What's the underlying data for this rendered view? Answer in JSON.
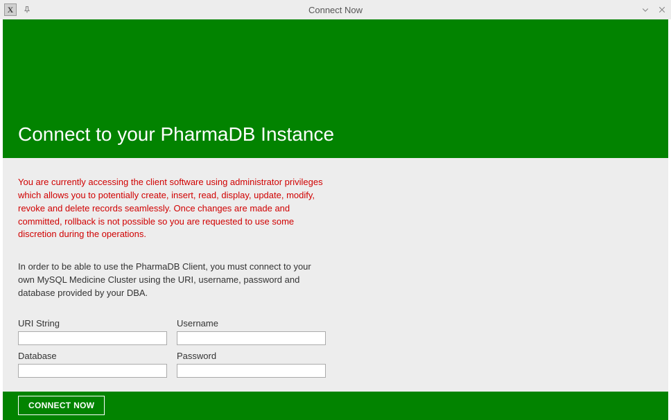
{
  "window": {
    "title": "Connect Now",
    "app_icon_letter": "X"
  },
  "header": {
    "title": "Connect to your PharmaDB Instance"
  },
  "body": {
    "warning": "You are currently accessing the client software using administrator privileges which allows you to potentially create, insert, read, display, update, modify, revoke and delete records seamlessly. Once changes are made and committed, rollback is not possible so you are requested to use some discretion during the operations.",
    "info": "In order to be able to use the PharmaDB Client, you must connect to your own MySQL Medicine Cluster using the URI, username, password and database provided by your DBA.",
    "labels": {
      "uri": "URI String",
      "username": "Username",
      "database": "Database",
      "password": "Password"
    },
    "values": {
      "uri": "",
      "username": "",
      "database": "",
      "password": ""
    }
  },
  "footer": {
    "connect_label": "CONNECT NOW"
  }
}
